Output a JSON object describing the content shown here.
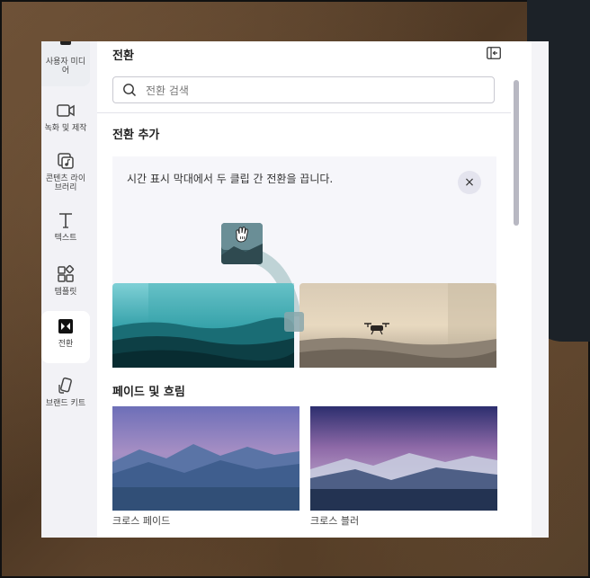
{
  "sidebar": {
    "items": [
      {
        "label": "사용자 미디어",
        "icon": "media-icon"
      },
      {
        "label": "녹화 및 제작",
        "icon": "video-camera-icon"
      },
      {
        "label": "콘텐츠 라이브러리",
        "icon": "content-library-icon"
      },
      {
        "label": "텍스트",
        "icon": "text-icon"
      },
      {
        "label": "템플릿",
        "icon": "templates-icon"
      },
      {
        "label": "전환",
        "icon": "transitions-icon",
        "active": true
      },
      {
        "label": "브랜드 키트",
        "icon": "brand-kit-icon"
      }
    ]
  },
  "header": {
    "title": "전환"
  },
  "search": {
    "placeholder": "전환 검색"
  },
  "add_section": {
    "title": "전환 추가",
    "hint": "시간 표시 막대에서 두 클립 간 전환을 끕니다.",
    "close_label": "×"
  },
  "fade_section": {
    "title": "페이드 및 흐림",
    "items": [
      {
        "label": "크로스 페이드"
      },
      {
        "label": "크로스 블러"
      }
    ]
  },
  "colors": {
    "accent": "#5a4fcf",
    "panel": "#ffffff",
    "rail": "#f2f2f6"
  }
}
